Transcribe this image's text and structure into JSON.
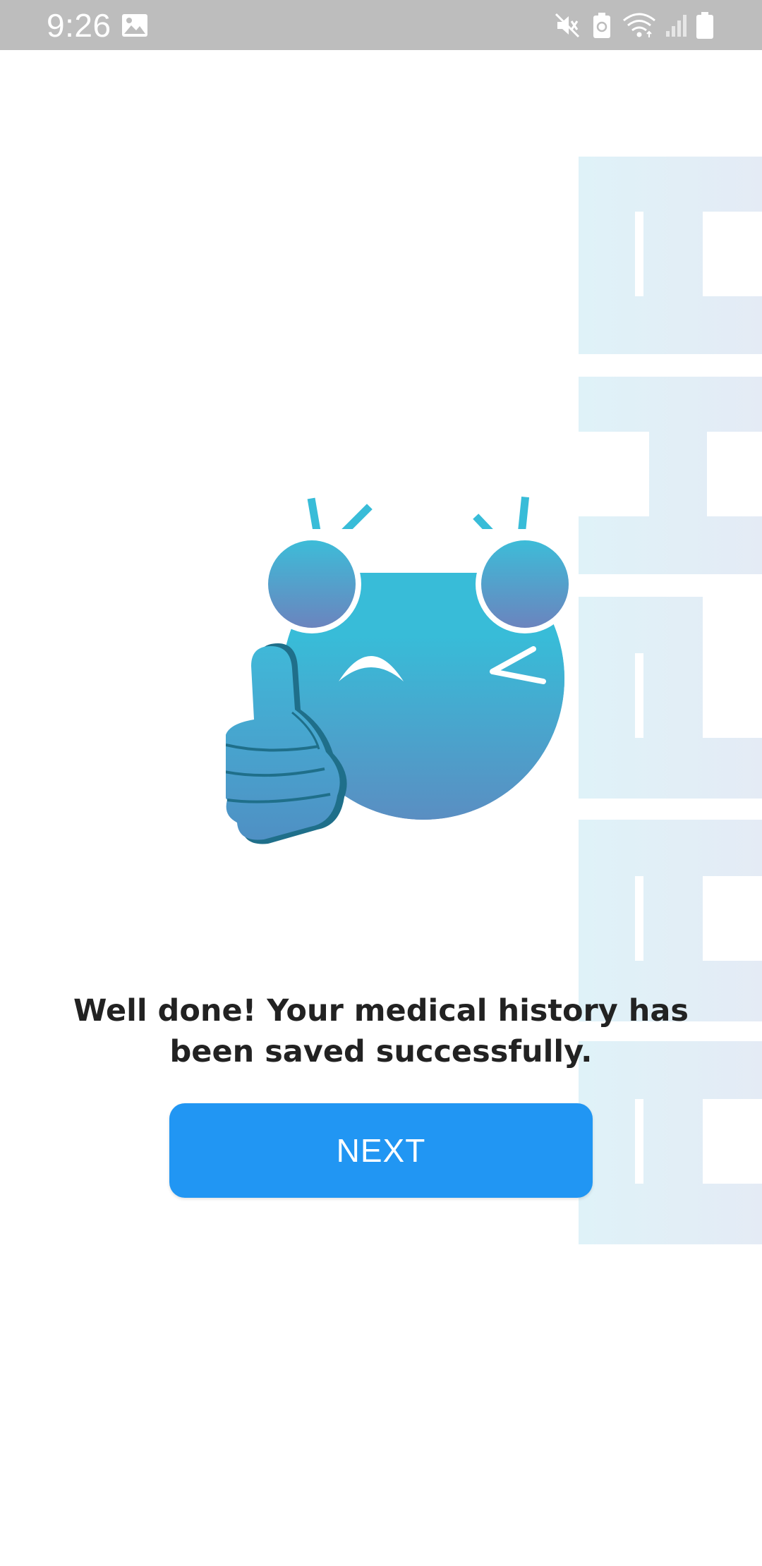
{
  "status_bar": {
    "time": "9:26",
    "icons": [
      "gallery-icon",
      "mute-icon",
      "battery-saver-icon",
      "wifi-icon",
      "signal-icon",
      "battery-icon"
    ]
  },
  "illustration": {
    "description_icon": "thumbs-up-mascot-icon",
    "colors": {
      "face_top": "#38bcd8",
      "face_bottom": "#5a8fc2",
      "button": "#2196f3",
      "side_art": "#dff0f7"
    }
  },
  "message": {
    "text": "Well done! Your medical history has been saved successfully."
  },
  "actions": {
    "next_label": "NEXT"
  }
}
